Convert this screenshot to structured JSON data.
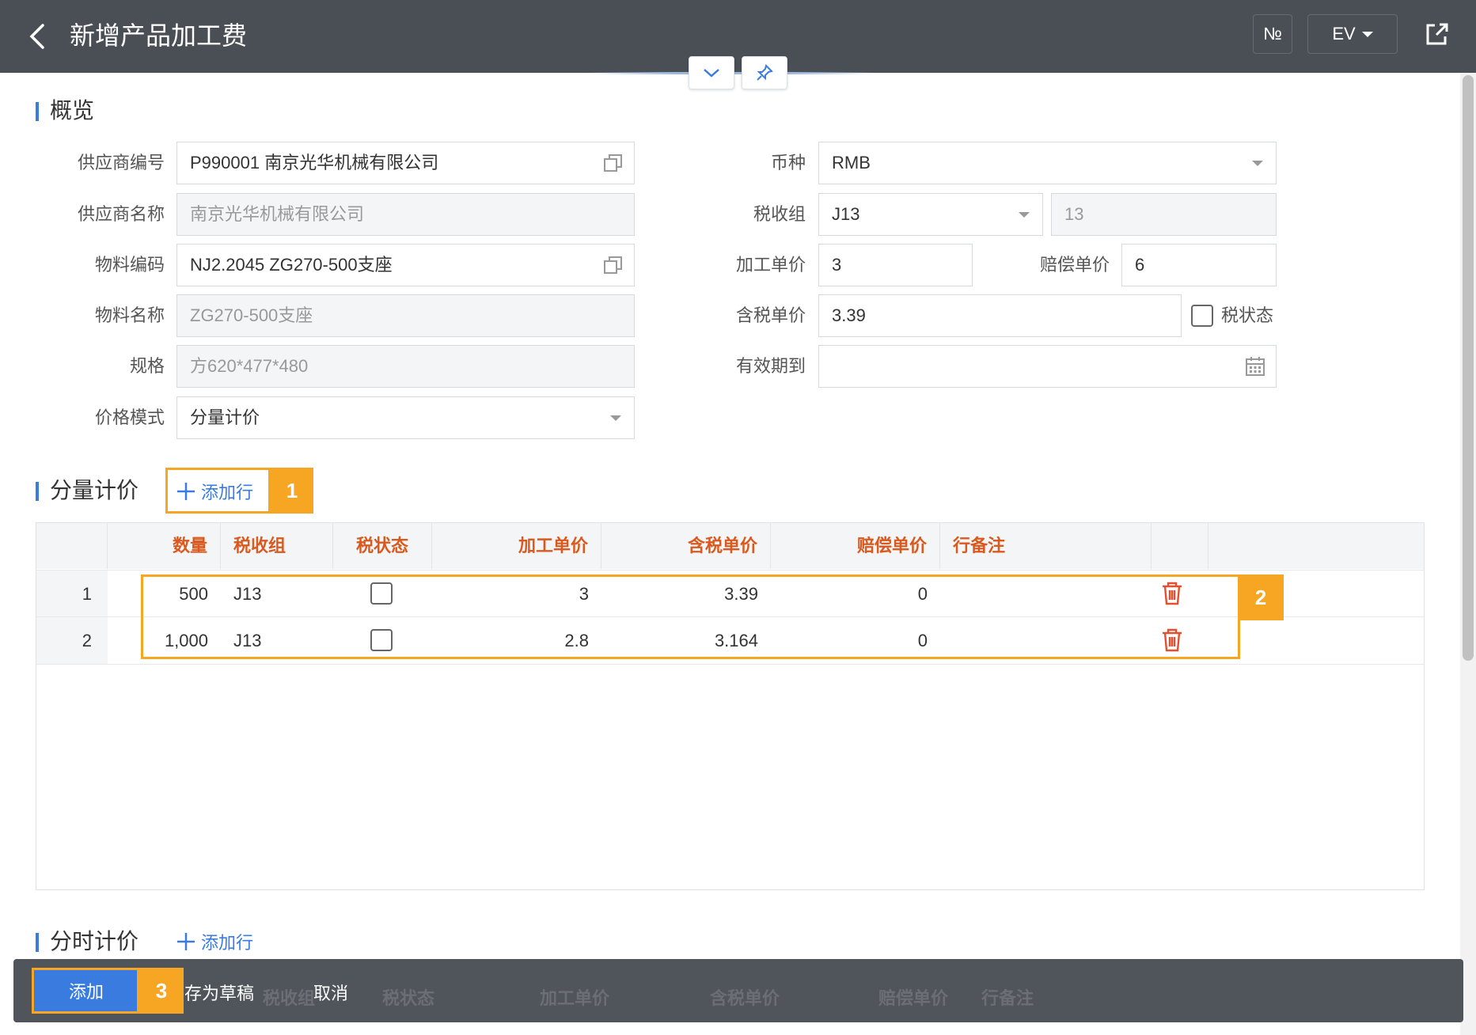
{
  "header": {
    "title": "新增产品加工费",
    "no_label": "№",
    "lang_label": "EV"
  },
  "overview": {
    "title": "概览",
    "supplier_code_label": "供应商编号",
    "supplier_code_value": "P990001 南京光华机械有限公司",
    "supplier_name_label": "供应商名称",
    "supplier_name_value": "南京光华机械有限公司",
    "material_code_label": "物料编码",
    "material_code_value": "NJ2.2045 ZG270-500支座",
    "material_name_label": "物料名称",
    "material_name_value": "ZG270-500支座",
    "spec_label": "规格",
    "spec_value": "方620*477*480",
    "price_mode_label": "价格模式",
    "price_mode_value": "分量计价",
    "currency_label": "币种",
    "currency_value": "RMB",
    "tax_group_label": "税收组",
    "tax_group_value": "J13",
    "tax_rate_value": "13",
    "unit_price_label": "加工单价",
    "unit_price_value": "3",
    "comp_price_label": "赔偿单价",
    "comp_price_value": "6",
    "tax_incl_label": "含税单价",
    "tax_incl_value": "3.39",
    "tax_status_label": "税状态",
    "valid_until_label": "有效期到",
    "valid_until_value": ""
  },
  "qty_pricing": {
    "title": "分量计价",
    "add_row": "添加行",
    "badge": "1",
    "columns": [
      "数量",
      "税收组",
      "税状态",
      "加工单价",
      "含税单价",
      "赔偿单价",
      "行备注"
    ],
    "rows": [
      {
        "num": "1",
        "qty": "500",
        "tax_group": "J13",
        "unit_price": "3",
        "tax_incl": "3.39",
        "comp": "0",
        "note": ""
      },
      {
        "num": "2",
        "qty": "1,000",
        "tax_group": "J13",
        "unit_price": "2.8",
        "tax_incl": "3.164",
        "comp": "0",
        "note": ""
      }
    ],
    "rows_badge": "2"
  },
  "time_pricing": {
    "title": "分时计价",
    "add_row": "添加行"
  },
  "footer": {
    "add": "添加",
    "save_draft": "存为草稿",
    "cancel": "取消",
    "badge": "3",
    "ghost_columns": [
      "税收组",
      "税状态",
      "加工单价",
      "含税单价",
      "赔偿单价",
      "行备注"
    ]
  },
  "colors": {
    "accent": "#3a7be0",
    "highlight": "#f6a623",
    "header_bg": "#4a4f56",
    "column_header": "#d9591e",
    "delete": "#e2502f"
  }
}
